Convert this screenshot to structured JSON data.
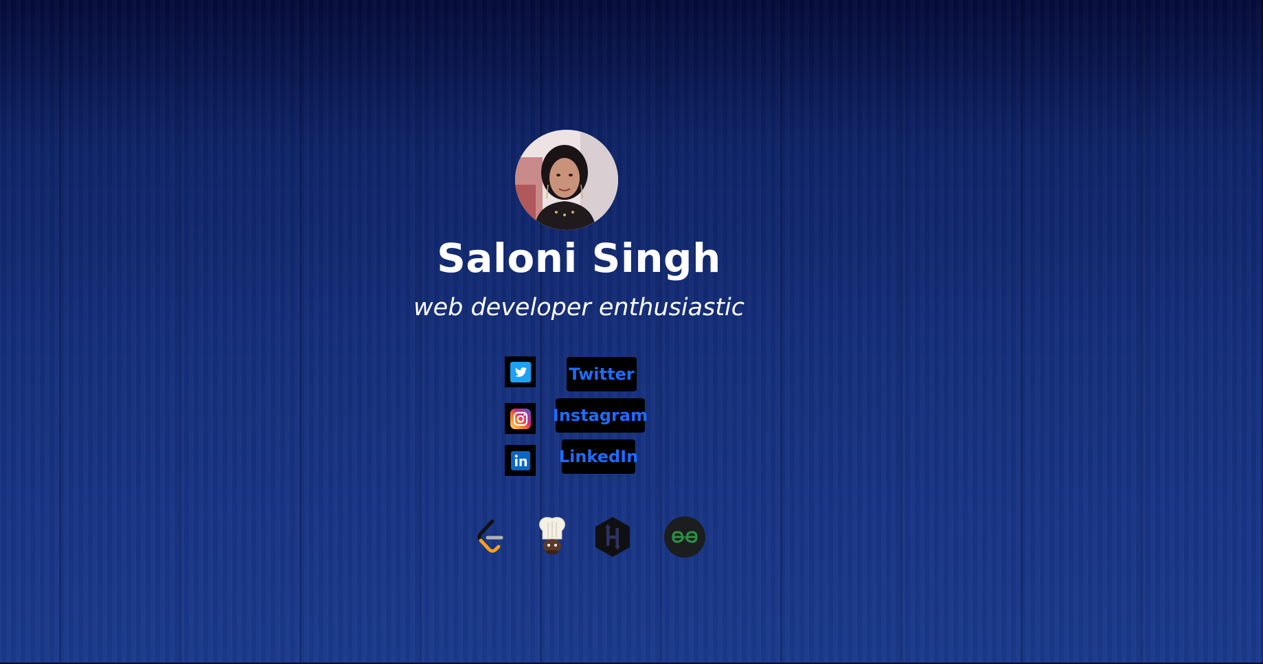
{
  "profile": {
    "name": "Saloni Singh",
    "tagline": "web developer enthusiastic",
    "avatar_icon": "profile-photo"
  },
  "social_links": [
    {
      "label": "Twitter",
      "icon": "twitter-icon",
      "color": "#1da1f2"
    },
    {
      "label": "Instagram",
      "icon": "instagram-icon",
      "color": "#e1306c"
    },
    {
      "label": "LinkedIn",
      "icon": "linkedin-icon",
      "color": "#0a66c2"
    }
  ],
  "coding_platforms": [
    {
      "icon": "leetcode-icon"
    },
    {
      "icon": "codechef-icon"
    },
    {
      "icon": "hackerrank-icon"
    },
    {
      "icon": "geeksforgeeks-icon"
    }
  ],
  "colors": {
    "background_top": "#050c3a",
    "background_bottom": "#1b3a8c",
    "link_text": "#1e6bff",
    "button_bg": "#000000"
  }
}
